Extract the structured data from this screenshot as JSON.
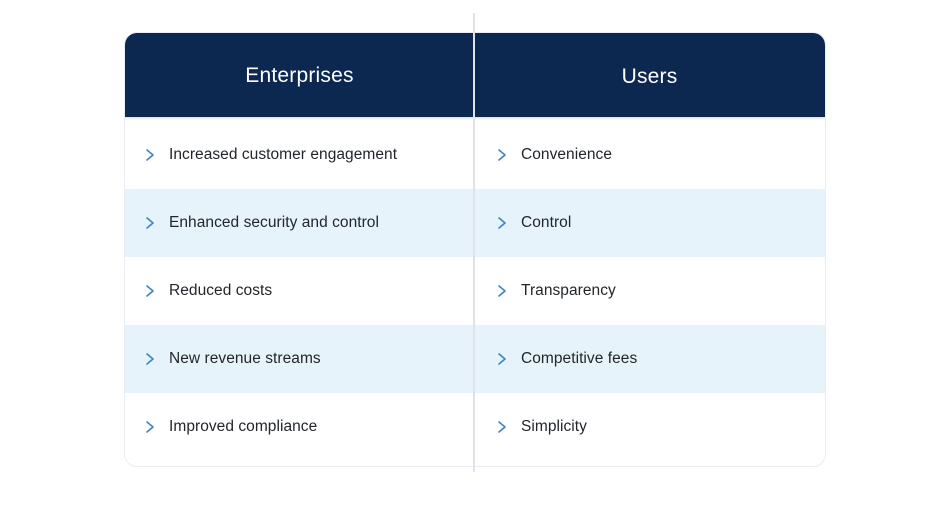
{
  "table": {
    "columns": [
      {
        "id": "enterprises",
        "header": "Enterprises"
      },
      {
        "id": "users",
        "header": "Users"
      }
    ],
    "rows": [
      {
        "enterprises": "Increased customer engagement",
        "users": "Convenience",
        "shaded": false
      },
      {
        "enterprises": "Enhanced security and control",
        "users": "Control",
        "shaded": true
      },
      {
        "enterprises": "Reduced costs",
        "users": "Transparency",
        "shaded": false
      },
      {
        "enterprises": "New revenue streams",
        "users": "Competitive fees",
        "shaded": true
      },
      {
        "enterprises": "Improved compliance",
        "users": "Simplicity",
        "shaded": false
      }
    ],
    "bullet_icon": "chevron-right-icon"
  },
  "colors": {
    "header_background": "#0c2850",
    "header_text": "#ffffff",
    "row_shaded_background": "#e7f3fb",
    "row_plain_background": "#ffffff",
    "chevron": "#3f86c4",
    "item_text": "#22262b",
    "card_border": "#e9edf2",
    "divider": "#dfe3e8",
    "page_background": "#ffffff"
  }
}
